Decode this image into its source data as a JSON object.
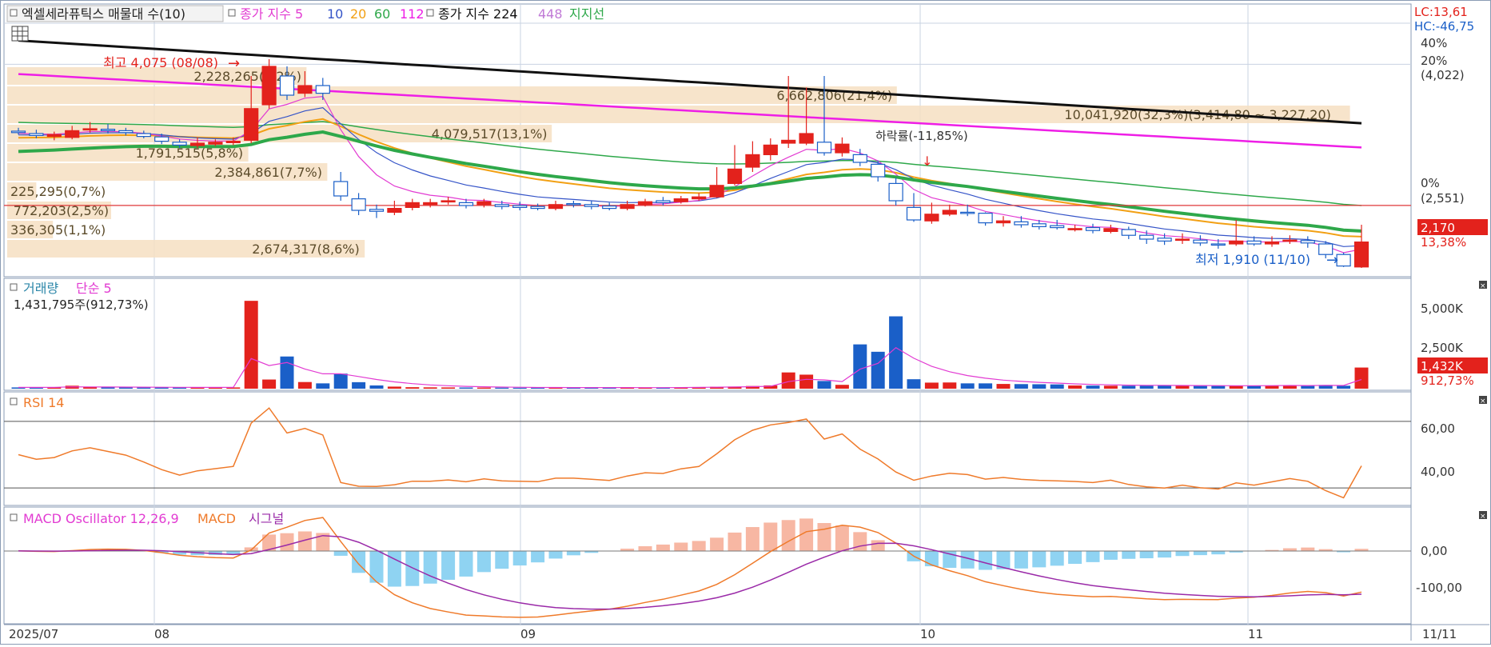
{
  "colors": {
    "up": "#e3221c",
    "down": "#1a5fc8",
    "ma5": "#e23bd2",
    "ma10": "#3554c8",
    "ma20": "#f2a014",
    "ma60": "#2ea84a",
    "ma112": "#ee1ee6",
    "ma224": "#111111",
    "support": "#e23a3a",
    "rsi": "#ef7a2a",
    "macd": "#ef7a2a",
    "signal": "#9a2aa8",
    "osc_pos": "#f7b7a3",
    "osc_neg": "#8fd3f2",
    "grid": "#c9d3e2",
    "profile": "#f6dfc2"
  },
  "price_panel": {
    "legend": {
      "title": "엑셀세라퓨틱스 매물대 수(10)",
      "ma_label": "종가 지수 5",
      "ma_10": "10",
      "ma_20": "20",
      "ma_60": "60",
      "ma_112": "112",
      "ma224_label": "종가 지수 224",
      "ma_448": "448",
      "support_label": "지지선"
    },
    "lc": "LC:13,61",
    "hc": "HC:-46,75",
    "axis_ticks": [
      "40%",
      "20%",
      "(4,022)",
      "0%",
      "(2,551)"
    ],
    "last_price": "2,170",
    "last_change": "13,38%",
    "high_note": "최고 4,075 (08/08)",
    "low_note": "최저 1,910 (11/10)",
    "drop_note": "하락률(-11,85%)",
    "volume_profile": [
      "2,674,317(8,6%)",
      "336,305(1,1%)",
      "772,203(2,5%)",
      "225,295(0,7%)",
      "2,384,861(7,7%)",
      "1,791,515(5,8%)",
      "4,079,517(13,1%)",
      "10,041,920(32,3%)(3,414,80 ~ 3,227,20)",
      "6,662,806(21,4%)",
      "2,228,265(7,2%)"
    ]
  },
  "volume_panel": {
    "title": "거래량",
    "ma_label": "단순 5",
    "current": "1,431,795주(912,73%)",
    "axis_ticks": [
      "5,000K",
      "2,500K"
    ],
    "last_value": "1,432K",
    "last_pct": "912,73%"
  },
  "rsi_panel": {
    "title": "RSI 14",
    "axis_ticks": [
      "60,00",
      "40,00"
    ]
  },
  "macd_panel": {
    "title": "MACD Oscillator 12,26,9",
    "macd_label": "MACD",
    "signal_label": "시그널",
    "axis_ticks": [
      "0,00",
      "-100,00"
    ]
  },
  "x_axis": {
    "labels": [
      "2025/07",
      "08",
      "09",
      "10",
      "11",
      "11/11"
    ]
  },
  "chart_data": {
    "type": "candlestick",
    "title": "엑셀세라퓨틱스",
    "candles": [
      [
        3325,
        3310,
        3360,
        3290
      ],
      [
        3300,
        3280,
        3340,
        3250
      ],
      [
        3270,
        3290,
        3320,
        3230
      ],
      [
        3260,
        3330,
        3380,
        3240
      ],
      [
        3340,
        3350,
        3420,
        3310
      ],
      [
        3345,
        3330,
        3400,
        3300
      ],
      [
        3330,
        3310,
        3360,
        3280
      ],
      [
        3300,
        3270,
        3330,
        3250
      ],
      [
        3265,
        3220,
        3300,
        3190
      ],
      [
        3210,
        3180,
        3240,
        3150
      ],
      [
        3175,
        3200,
        3260,
        3150
      ],
      [
        3190,
        3210,
        3240,
        3170
      ],
      [
        3205,
        3220,
        3260,
        3180
      ],
      [
        3230,
        3560,
        3900,
        3200
      ],
      [
        3600,
        4000,
        4075,
        3560
      ],
      [
        3900,
        3700,
        4000,
        3650
      ],
      [
        3720,
        3800,
        3950,
        3680
      ],
      [
        3800,
        3720,
        3880,
        3650
      ],
      [
        2800,
        2650,
        2900,
        2600
      ],
      [
        2620,
        2500,
        2680,
        2450
      ],
      [
        2510,
        2490,
        2560,
        2420
      ],
      [
        2480,
        2520,
        2600,
        2450
      ],
      [
        2530,
        2580,
        2620,
        2500
      ],
      [
        2560,
        2580,
        2620,
        2530
      ],
      [
        2590,
        2600,
        2640,
        2560
      ],
      [
        2580,
        2550,
        2620,
        2520
      ],
      [
        2560,
        2590,
        2620,
        2530
      ],
      [
        2560,
        2540,
        2600,
        2510
      ],
      [
        2550,
        2530,
        2590,
        2500
      ],
      [
        2540,
        2520,
        2570,
        2500
      ],
      [
        2520,
        2560,
        2600,
        2500
      ],
      [
        2570,
        2560,
        2600,
        2530
      ],
      [
        2560,
        2540,
        2600,
        2510
      ],
      [
        2545,
        2520,
        2580,
        2500
      ],
      [
        2520,
        2560,
        2600,
        2500
      ],
      [
        2560,
        2590,
        2620,
        2540
      ],
      [
        2600,
        2580,
        2640,
        2550
      ],
      [
        2590,
        2620,
        2650,
        2570
      ],
      [
        2620,
        2640,
        2680,
        2600
      ],
      [
        2640,
        2760,
        2950,
        2630
      ],
      [
        2780,
        2930,
        3180,
        2760
      ],
      [
        2950,
        3080,
        3220,
        2900
      ],
      [
        3080,
        3180,
        3250,
        3020
      ],
      [
        3200,
        3230,
        3900,
        3150
      ],
      [
        3200,
        3300,
        3780,
        3180
      ],
      [
        3210,
        3100,
        3900,
        3070
      ],
      [
        3100,
        3190,
        3260,
        3060
      ],
      [
        3080,
        3000,
        3140,
        2960
      ],
      [
        2980,
        2850,
        3020,
        2800
      ],
      [
        2780,
        2600,
        2840,
        2550
      ],
      [
        2530,
        2400,
        2680,
        2380
      ],
      [
        2390,
        2460,
        2580,
        2360
      ],
      [
        2460,
        2500,
        2560,
        2440
      ],
      [
        2480,
        2470,
        2560,
        2440
      ],
      [
        2470,
        2370,
        2480,
        2340
      ],
      [
        2370,
        2390,
        2440,
        2330
      ],
      [
        2380,
        2350,
        2440,
        2320
      ],
      [
        2360,
        2330,
        2400,
        2300
      ],
      [
        2340,
        2320,
        2400,
        2300
      ],
      [
        2300,
        2310,
        2350,
        2280
      ],
      [
        2320,
        2290,
        2360,
        2260
      ],
      [
        2280,
        2310,
        2350,
        2260
      ],
      [
        2300,
        2240,
        2330,
        2200
      ],
      [
        2240,
        2200,
        2290,
        2150
      ],
      [
        2210,
        2180,
        2260,
        2140
      ],
      [
        2190,
        2200,
        2260,
        2150
      ],
      [
        2190,
        2160,
        2240,
        2130
      ],
      [
        2150,
        2140,
        2200,
        2100
      ],
      [
        2150,
        2180,
        2400,
        2130
      ],
      [
        2180,
        2150,
        2230,
        2130
      ],
      [
        2150,
        2170,
        2230,
        2120
      ],
      [
        2180,
        2190,
        2240,
        2150
      ],
      [
        2185,
        2160,
        2230,
        2110
      ],
      [
        2150,
        2040,
        2180,
        2000
      ],
      [
        2040,
        1920,
        2060,
        1910
      ],
      [
        1910,
        2170,
        2350,
        1900
      ]
    ],
    "volume_k": [
      85,
      80,
      90,
      200,
      110,
      100,
      95,
      90,
      85,
      80,
      80,
      80,
      85,
      5950,
      620,
      2180,
      450,
      360,
      1020,
      440,
      220,
      140,
      100,
      90,
      85,
      80,
      75,
      70,
      65,
      60,
      80,
      70,
      75,
      80,
      70,
      65,
      70,
      80,
      110,
      130,
      140,
      180,
      220,
      1100,
      950,
      520,
      260,
      3000,
      2500,
      4900,
      640,
      410,
      420,
      360,
      360,
      320,
      310,
      300,
      290,
      220,
      210,
      200,
      200,
      210,
      220,
      200,
      200,
      190,
      190,
      200,
      210,
      240,
      200,
      250,
      200,
      1432
    ],
    "rsi_range": [
      20,
      80
    ],
    "y_range_price": [
      1850,
      4450
    ]
  }
}
